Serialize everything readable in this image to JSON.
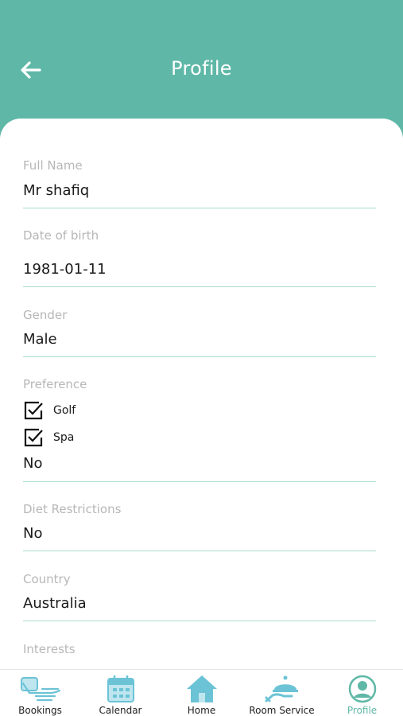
{
  "header": {
    "title": "Profile"
  },
  "fields": {
    "full_name": {
      "label": "Full Name",
      "value": "Mr shafiq"
    },
    "dob": {
      "label": "Date of birth",
      "value": "1981-01-11"
    },
    "gender": {
      "label": "Gender",
      "value": "Male"
    },
    "preference": {
      "label": "Preference",
      "options": [
        {
          "label": "Golf",
          "checked": true
        },
        {
          "label": "Spa",
          "checked": true
        }
      ],
      "value": "No"
    },
    "diet": {
      "label": "Diet Restrictions",
      "value": "No"
    },
    "country": {
      "label": "Country",
      "value": "Australia"
    },
    "interests": {
      "label": "Interests"
    }
  },
  "tabbar": {
    "items": [
      {
        "label": "Bookings",
        "icon": "bookings-icon"
      },
      {
        "label": "Calendar",
        "icon": "calendar-icon"
      },
      {
        "label": "Home",
        "icon": "home-icon"
      },
      {
        "label": "Room Service",
        "icon": "room-service-icon"
      },
      {
        "label": "Profile",
        "icon": "profile-icon",
        "active": true
      }
    ]
  },
  "colors": {
    "accent": "#5fb8a7",
    "divider": "#a8dccf",
    "icon_blue": "#6cc3d6"
  }
}
